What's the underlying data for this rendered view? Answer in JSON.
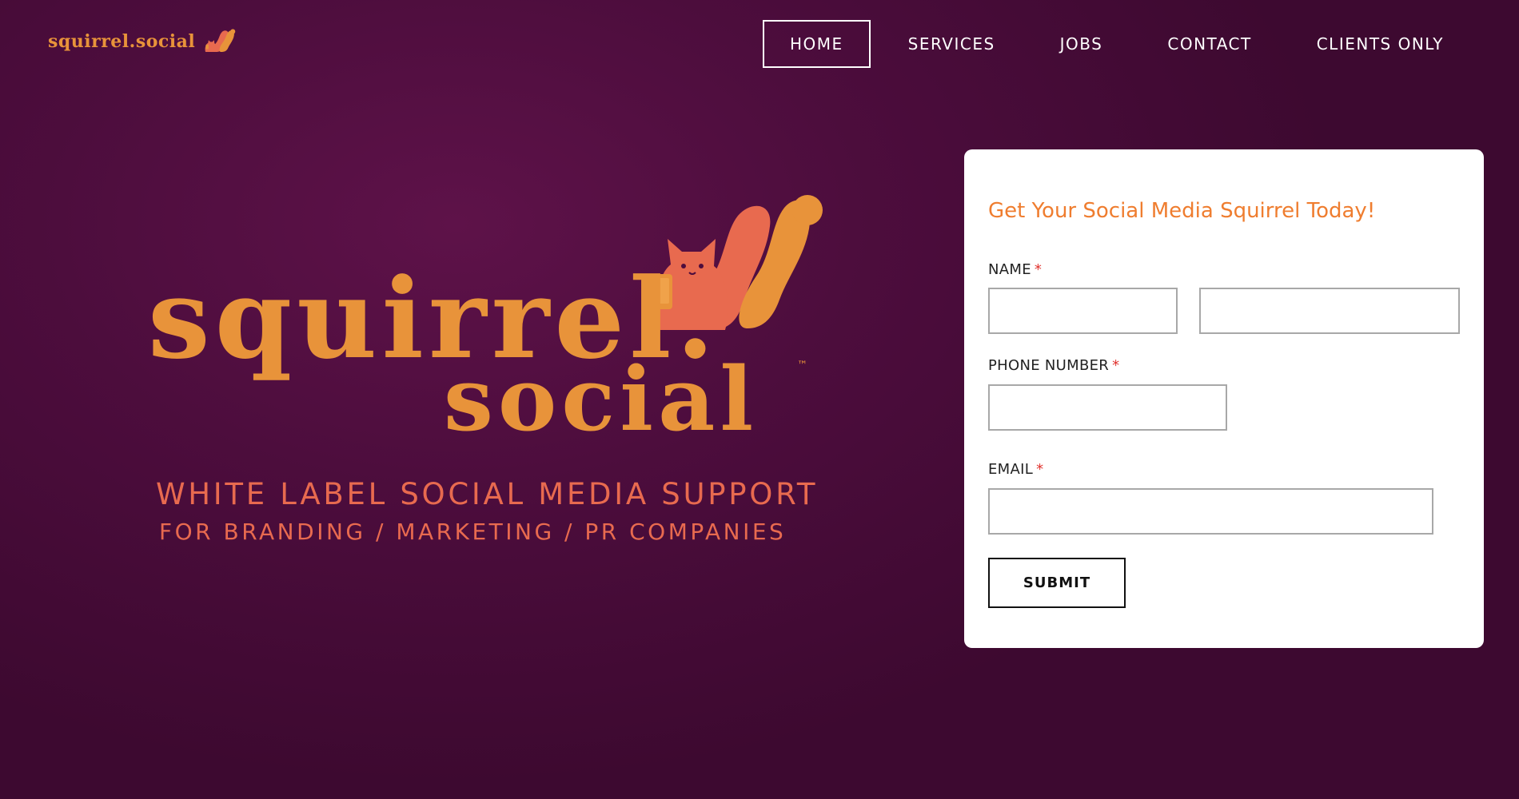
{
  "header": {
    "logo_text": "squirrel.social",
    "nav": [
      {
        "label": "HOME",
        "active": true
      },
      {
        "label": "SERVICES",
        "active": false
      },
      {
        "label": "JOBS",
        "active": false
      },
      {
        "label": "CONTACT",
        "active": false
      },
      {
        "label": "CLIENTS ONLY",
        "active": false
      }
    ]
  },
  "hero": {
    "wordmark_line1": "squirrel.",
    "wordmark_line2": "social",
    "trademark": "™",
    "tagline_line1": "WHITE LABEL SOCIAL MEDIA SUPPORT",
    "tagline_line2": "FOR BRANDING / MARKETING / PR COMPANIES"
  },
  "form": {
    "title": "Get Your Social Media Squirrel Today!",
    "name_label": "NAME",
    "first_name_value": "",
    "last_name_value": "",
    "phone_label": "PHONE NUMBER",
    "phone_value": "",
    "email_label": "EMAIL",
    "email_value": "",
    "required_marker": "*",
    "submit_label": "SUBMIT"
  },
  "colors": {
    "background": "#4d0d3d",
    "brand_orange": "#e8933a",
    "tagline_coral": "#e86a4f",
    "form_title_orange": "#ef7d2f",
    "required_red": "#e0312d"
  },
  "icons": {
    "logo_mark": "squirrel-icon"
  }
}
